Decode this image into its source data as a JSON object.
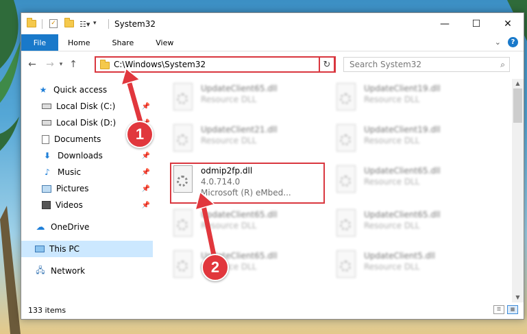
{
  "window": {
    "title": "System32"
  },
  "window_buttons": {
    "minimize": "—",
    "maximize": "☐",
    "close": "✕"
  },
  "ribbon": {
    "tabs": [
      "File",
      "Home",
      "Share",
      "View"
    ],
    "help": "?",
    "expand": "⌄"
  },
  "nav": {
    "address": "C:\\Windows\\System32",
    "search_placeholder": "Search System32"
  },
  "sidebar": {
    "items": [
      {
        "label": "Quick access",
        "icon": "star-icon"
      },
      {
        "label": "Local Disk (C:)",
        "icon": "drive-icon"
      },
      {
        "label": "Local Disk (D:)",
        "icon": "drive-icon"
      },
      {
        "label": "Documents",
        "icon": "documents-icon"
      },
      {
        "label": "Downloads",
        "icon": "download-icon"
      },
      {
        "label": "Music",
        "icon": "music-icon"
      },
      {
        "label": "Pictures",
        "icon": "pictures-icon"
      },
      {
        "label": "Videos",
        "icon": "videos-icon"
      },
      {
        "label": "OneDrive",
        "icon": "cloud-icon"
      },
      {
        "label": "This PC",
        "icon": "computer-icon"
      },
      {
        "label": "Network",
        "icon": "network-icon"
      }
    ]
  },
  "files": [
    {
      "name": "UpdateClient65.dll",
      "line2": "Resource DLL"
    },
    {
      "name": "UpdateClient19.dll",
      "line2": "Resource DLL"
    },
    {
      "name": "UpdateClient21.dll",
      "line2": "Resource DLL"
    },
    {
      "name": "UpdateClient19.dll",
      "line2": "Resource DLL"
    },
    {
      "name": "odmip2fp.dll",
      "line2": "4.0.714.0",
      "line3": "Microsoft (R) eMbed..."
    },
    {
      "name": "UpdateClient65.dll",
      "line2": "Resource DLL"
    },
    {
      "name": "UpdateClient65.dll",
      "line2": "Resource DLL"
    },
    {
      "name": "UpdateClient65.dll",
      "line2": "Resource DLL"
    },
    {
      "name": "UpdateClient65.dll",
      "line2": "Resource DLL"
    },
    {
      "name": "UpdateClient5.dll",
      "line2": "Resource DLL"
    }
  ],
  "status": {
    "items_count": "133 items"
  },
  "annotations": {
    "step1": "1",
    "step2": "2"
  },
  "colors": {
    "accent": "#1979ca",
    "annotation": "#e1373d",
    "selection": "#cce8ff"
  }
}
